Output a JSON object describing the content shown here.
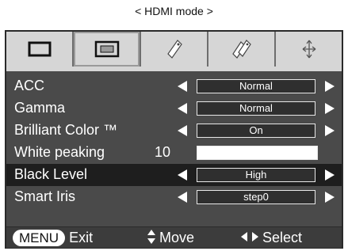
{
  "caption": "< HDMI mode >",
  "tabs": [
    {
      "name": "picture-size-icon"
    },
    {
      "name": "screen-icon"
    },
    {
      "name": "tag-icon"
    },
    {
      "name": "tags-icon"
    },
    {
      "name": "arrows-icon"
    }
  ],
  "rows": {
    "acc": {
      "label": "ACC",
      "value": "Normal"
    },
    "gamma": {
      "label": "Gamma",
      "value": "Normal"
    },
    "brilliant_color": {
      "label": "Brilliant Color ™",
      "value": "On"
    },
    "white_peaking": {
      "label": "White peaking",
      "value": "10",
      "level": 1.0
    },
    "black_level": {
      "label": "Black Level",
      "value": "High"
    },
    "smart_iris": {
      "label": "Smart Iris",
      "value": "step0"
    }
  },
  "footer": {
    "menu_key": "MENU",
    "exit_label": "Exit",
    "move_label": "Move",
    "select_label": "Select"
  },
  "colors": {
    "osd_bg": "#4a4a4a",
    "selected_row_bg": "#1e1e1e",
    "tab_bg": "#d6d6d6"
  }
}
